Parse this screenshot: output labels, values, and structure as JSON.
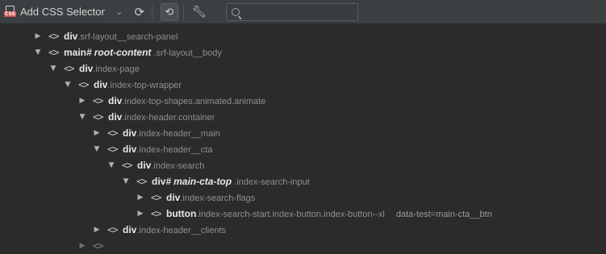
{
  "toolbar": {
    "title": "Add CSS Selector",
    "css_icon_label": "CSS",
    "search_placeholder": "",
    "search_value": ""
  },
  "tree": [
    {
      "tag": "div",
      "id": "",
      "cls": ".srf-layout__search-panel",
      "attr": "",
      "expanded": false
    },
    {
      "tag": "main",
      "id": "#",
      "idname": "root-content",
      "cls": ".srf-layout__body",
      "attr": "",
      "expanded": true
    },
    {
      "tag": "div",
      "id": "",
      "cls": ".index-page",
      "attr": "",
      "expanded": true
    },
    {
      "tag": "div",
      "id": "",
      "cls": ".index-top-wrapper",
      "attr": "",
      "expanded": true
    },
    {
      "tag": "div",
      "id": "",
      "cls": ".index-top-shapes.animated.animate",
      "attr": "",
      "expanded": false
    },
    {
      "tag": "div",
      "id": "",
      "cls": ".index-header.container",
      "attr": "",
      "expanded": true
    },
    {
      "tag": "div",
      "id": "",
      "cls": ".index-header__main",
      "attr": "",
      "expanded": false
    },
    {
      "tag": "div",
      "id": "",
      "cls": ".index-header__cta",
      "attr": "",
      "expanded": true
    },
    {
      "tag": "div",
      "id": "",
      "cls": ".index-search",
      "attr": "",
      "expanded": true
    },
    {
      "tag": "div",
      "id": "#",
      "idname": "main-cta-top",
      "cls": ".index-search-input",
      "attr": "",
      "expanded": true
    },
    {
      "tag": "div",
      "id": "",
      "cls": ".index-search-flags",
      "attr": "",
      "expanded": false
    },
    {
      "tag": "button",
      "id": "",
      "cls": ".index-search-start.index-button.index-button--xl",
      "attr": "data-test=main-cta__btn",
      "expanded": false
    },
    {
      "tag": "div",
      "id": "",
      "cls": ".index-header__clients",
      "attr": "",
      "expanded": false
    }
  ],
  "code_glyph": "<>",
  "icons": {
    "expanded": "chevron-down-icon",
    "collapsed": "chevron-right-icon"
  }
}
